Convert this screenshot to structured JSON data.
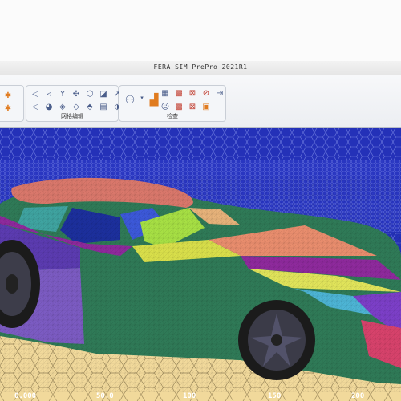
{
  "window": {
    "title": "FERA SIM PrePro 2021R1"
  },
  "ribbon": {
    "groups": [
      {
        "label": "网格编辑"
      },
      {
        "label": "检查"
      }
    ]
  },
  "viewport": {
    "axis_ticks": [
      "0.000",
      "50.0",
      "100",
      "150",
      "200"
    ]
  },
  "colors": {
    "background_mesh": "#2431b8",
    "ground_mesh": "#f1d99b",
    "car_body": "#2f7a57"
  }
}
